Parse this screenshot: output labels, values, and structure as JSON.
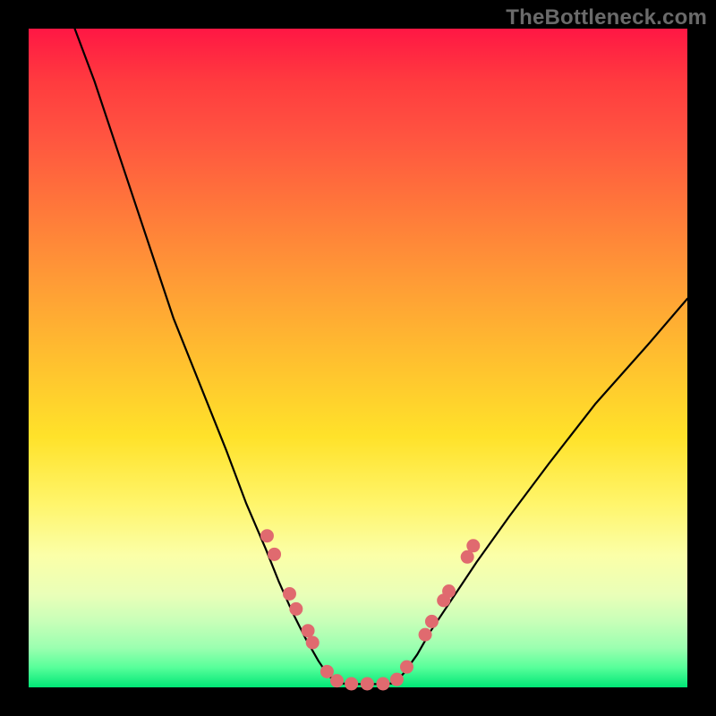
{
  "watermark": "TheBottleneck.com",
  "colors": {
    "frame": "#000000",
    "curve": "#000000",
    "marker": "#e06a6f"
  },
  "chart_data": {
    "type": "line",
    "title": "",
    "xlabel": "",
    "ylabel": "",
    "xlim": [
      0,
      100
    ],
    "ylim": [
      0,
      100
    ],
    "grid": false,
    "description": "V-shaped bottleneck curve with two branches descending steeply toward a small flat minimum, overlaid on a vertical rainbow gradient from red (high) to green (low). Markers cluster near the minimum on both branches.",
    "series": [
      {
        "name": "left-branch",
        "x": [
          7,
          10,
          14,
          18,
          22,
          26,
          30,
          33,
          36,
          38,
          40,
          42,
          44,
          45.5,
          47
        ],
        "y": [
          100,
          92,
          80,
          68,
          56,
          46,
          36,
          28,
          21,
          16,
          11.5,
          7.5,
          4,
          1.8,
          0.6
        ]
      },
      {
        "name": "flat-minimum",
        "x": [
          47,
          50,
          53,
          55.5
        ],
        "y": [
          0.6,
          0.5,
          0.5,
          0.6
        ]
      },
      {
        "name": "right-branch",
        "x": [
          55.5,
          57,
          59,
          61,
          64,
          68,
          73,
          79,
          86,
          94,
          100
        ],
        "y": [
          0.6,
          2.2,
          5,
          8.5,
          13,
          19,
          26,
          34,
          43,
          52,
          59
        ]
      }
    ],
    "markers": [
      {
        "x": 36.2,
        "y": 23.0
      },
      {
        "x": 37.3,
        "y": 20.2
      },
      {
        "x": 39.6,
        "y": 14.2
      },
      {
        "x": 40.6,
        "y": 11.9
      },
      {
        "x": 42.4,
        "y": 8.6
      },
      {
        "x": 43.1,
        "y": 6.8
      },
      {
        "x": 45.3,
        "y": 2.4
      },
      {
        "x": 46.8,
        "y": 1.0
      },
      {
        "x": 49.0,
        "y": 0.55
      },
      {
        "x": 51.4,
        "y": 0.55
      },
      {
        "x": 53.8,
        "y": 0.55
      },
      {
        "x": 55.9,
        "y": 1.2
      },
      {
        "x": 57.4,
        "y": 3.1
      },
      {
        "x": 60.2,
        "y": 8.0
      },
      {
        "x": 61.2,
        "y": 10.0
      },
      {
        "x": 63.0,
        "y": 13.2
      },
      {
        "x": 63.8,
        "y": 14.6
      },
      {
        "x": 66.6,
        "y": 19.8
      },
      {
        "x": 67.5,
        "y": 21.5
      }
    ],
    "marker_radius_px": 7.5
  }
}
